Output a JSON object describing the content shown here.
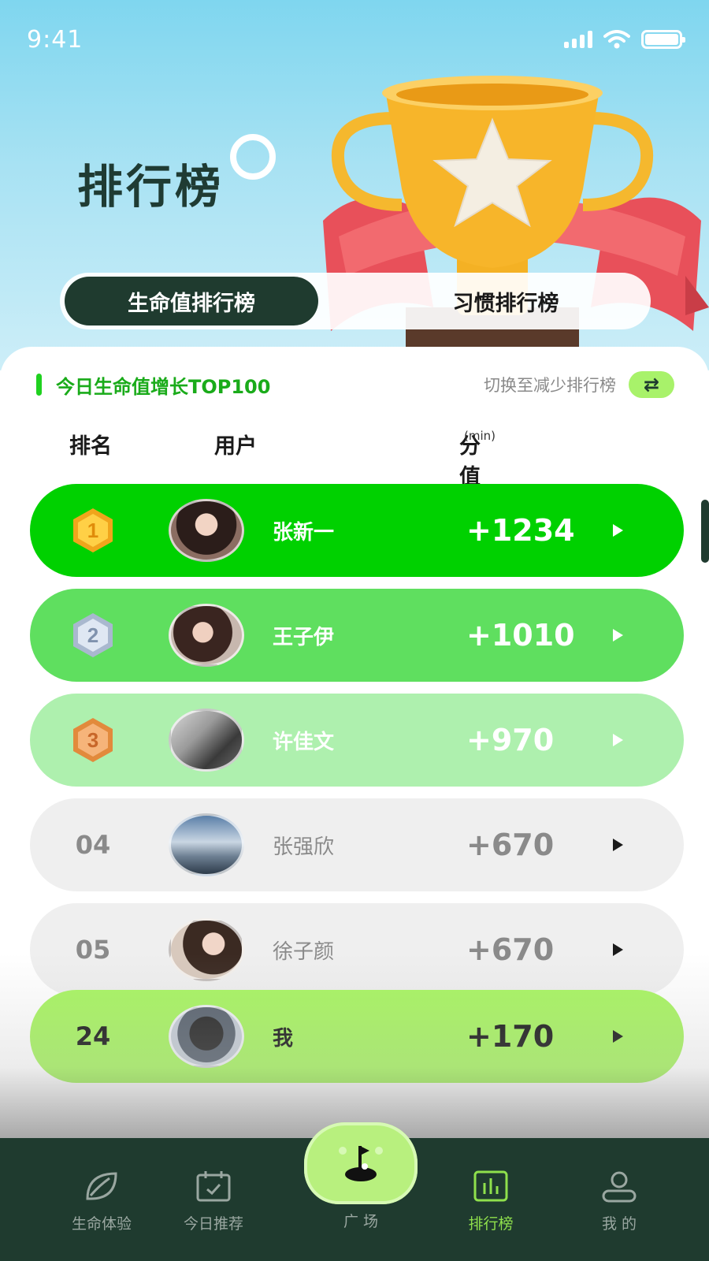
{
  "status_bar": {
    "time": "9:41"
  },
  "header": {
    "title": "排行榜"
  },
  "tabs": [
    {
      "label": "生命值排行榜",
      "active": true
    },
    {
      "label": "习惯排行榜",
      "active": false
    }
  ],
  "section": {
    "title": "今日生命值增长TOP100",
    "switch_label": "切换至减少排行榜",
    "switch_icon": "swap-icon"
  },
  "columns": {
    "rank": "排名",
    "user": "用户",
    "score": "分值变化",
    "score_unit": "(min)"
  },
  "rows": [
    {
      "rank": "1",
      "name": "张新一",
      "score": "+1234",
      "color": "#00d100"
    },
    {
      "rank": "2",
      "name": "王子伊",
      "score": "+1010",
      "color": "#5fdf5f"
    },
    {
      "rank": "3",
      "name": "许佳文",
      "score": "+970",
      "color": "#aef0ae"
    },
    {
      "rank": "04",
      "name": "张强欣",
      "score": "+670",
      "color": "#efefef"
    },
    {
      "rank": "05",
      "name": "徐子颜",
      "score": "+670",
      "color": "#efefef"
    },
    {
      "rank": "24",
      "name": "我",
      "score": "+170",
      "color": "#a8f562"
    }
  ],
  "nav": [
    {
      "label": "生命体验",
      "icon": "leaf-icon",
      "active": false
    },
    {
      "label": "今日推荐",
      "icon": "calendar-check-icon",
      "active": false
    },
    {
      "label": "广 场",
      "icon": "golf-flag-icon",
      "active": false
    },
    {
      "label": "排行榜",
      "icon": "bar-chart-icon",
      "active": true
    },
    {
      "label": "我 的",
      "icon": "user-icon",
      "active": false
    }
  ],
  "colors": {
    "brand_dark": "#1f3b2f",
    "accent_green": "#00d100",
    "nav_active": "#8fe04c"
  }
}
